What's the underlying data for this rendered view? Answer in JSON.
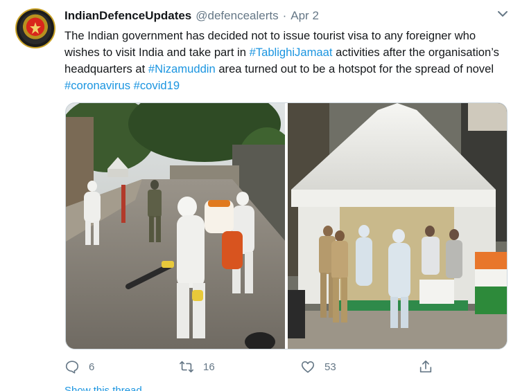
{
  "tweet": {
    "author_name": "IndianDefenceUpdates",
    "handle": "@defencealerts",
    "separator": "·",
    "date": "Apr 2",
    "text_parts": [
      {
        "text": "The Indian government has decided not to issue tourist visa to any foreigner who wishes to visit India and take part in ",
        "hashtag": false
      },
      {
        "text": "#TablighiJamaat",
        "hashtag": true
      },
      {
        "text": " activities after the organisation’s headquarters at ",
        "hashtag": false
      },
      {
        "text": "#Nizamuddin",
        "hashtag": true
      },
      {
        "text": " area turned out to be a hotspot for the spread of novel ",
        "hashtag": false
      },
      {
        "text": "#coronavirus",
        "hashtag": true
      },
      {
        "text": " ",
        "hashtag": false
      },
      {
        "text": "#covid19",
        "hashtag": true
      }
    ],
    "actions": {
      "replies": "6",
      "retweets": "16",
      "likes": "53"
    },
    "show_thread": "Show this thread"
  },
  "colors": {
    "link": "#1b95e0",
    "secondary": "#657786",
    "text": "#14171a"
  },
  "icons": {
    "reply": "speech-bubble-icon",
    "retweet": "retweet-arrows-icon",
    "like": "heart-icon",
    "share": "share-upload-icon",
    "caret": "chevron-down-icon"
  }
}
